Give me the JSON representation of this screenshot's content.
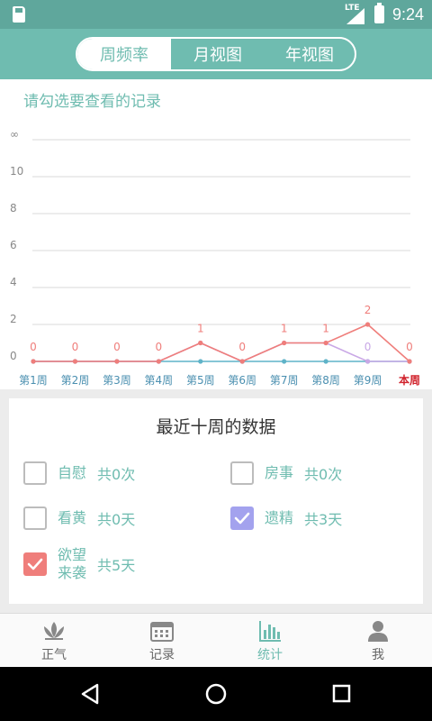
{
  "status": {
    "network": "LTE",
    "time": "9:24"
  },
  "tabs": [
    {
      "label": "周频率",
      "active": true
    },
    {
      "label": "月视图",
      "active": false
    },
    {
      "label": "年视图",
      "active": false
    }
  ],
  "chart_hint": "请勾选要查看的记录",
  "chart_data": {
    "type": "line",
    "categories": [
      "第1周",
      "第2周",
      "第3周",
      "第4周",
      "第5周",
      "第6周",
      "第7周",
      "第8周",
      "第9周",
      "本周"
    ],
    "y_tick_labels": [
      "0",
      "2",
      "4",
      "6",
      "8",
      "10",
      "∞"
    ],
    "y_ticks": [
      0,
      2,
      4,
      6,
      8,
      10,
      12
    ],
    "ylim": [
      0,
      12
    ],
    "grid": true,
    "series": [
      {
        "values": [
          0,
          0,
          0,
          0,
          0,
          0,
          0,
          0,
          0,
          0
        ],
        "color": "#5fb3c8",
        "labels_shown": false
      },
      {
        "values": [
          0,
          0,
          0,
          0,
          1,
          0,
          1,
          1,
          0,
          0
        ],
        "color": "#c9a8e6",
        "labels_shown": false,
        "point_labels": {
          "8": "0"
        }
      },
      {
        "values": [
          0,
          0,
          0,
          0,
          1,
          0,
          1,
          1,
          2,
          0
        ],
        "color": "#ef7e7b",
        "labels_shown": true
      }
    ],
    "highlight_category_color": "#d0202a"
  },
  "data_card": {
    "title": "最近十周的数据",
    "items": [
      {
        "label": "自慰",
        "count": "共0次",
        "checked": false,
        "color": ""
      },
      {
        "label": "房事",
        "count": "共0次",
        "checked": false,
        "color": ""
      },
      {
        "label": "看黄",
        "count": "共0天",
        "checked": false,
        "color": ""
      },
      {
        "label": "遗精",
        "count": "共3天",
        "checked": true,
        "color": "#a3a2ee"
      },
      {
        "label": "欲望\n来袭",
        "count": "共5天",
        "checked": true,
        "color": "#ef7e7b"
      }
    ]
  },
  "bottom_nav": [
    {
      "label": "正气",
      "icon": "lotus-icon",
      "active": false
    },
    {
      "label": "记录",
      "icon": "calendar-icon",
      "active": false
    },
    {
      "label": "统计",
      "icon": "bar-chart-icon",
      "active": true
    },
    {
      "label": "我",
      "icon": "person-icon",
      "active": false
    }
  ],
  "colors": {
    "accent": "#6fbcb0",
    "status_bar": "#5fa79c"
  }
}
